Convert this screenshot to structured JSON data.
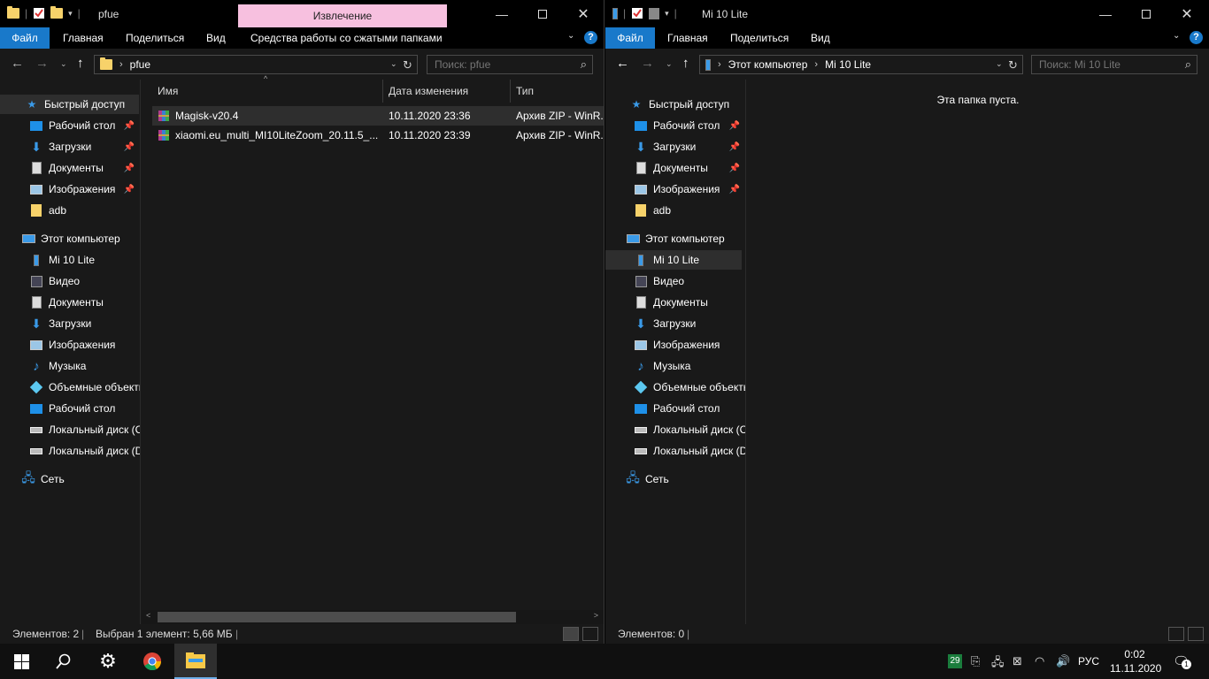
{
  "left_window": {
    "title": "pfue",
    "context_tab": "Извлечение",
    "ribbon_tabs": [
      "Файл",
      "Главная",
      "Поделиться",
      "Вид",
      "Средства работы со сжатыми папками"
    ],
    "address": {
      "crumbs": [
        "pfue"
      ]
    },
    "search_placeholder": "Поиск: pfue",
    "columns": [
      "Имя",
      "Дата изменения",
      "Тип"
    ],
    "files": [
      {
        "name": "Magisk-v20.4",
        "date": "10.11.2020 23:36",
        "type": "Архив ZIP - WinR..."
      },
      {
        "name": "xiaomi.eu_multi_MI10LiteZoom_20.11.5_...",
        "date": "10.11.2020 23:39",
        "type": "Архив ZIP - WinR..."
      }
    ],
    "status": {
      "count": "Элементов: 2",
      "selected": "Выбран 1 элемент: 5,66 МБ"
    }
  },
  "right_window": {
    "title": "Mi 10 Lite",
    "ribbon_tabs": [
      "Файл",
      "Главная",
      "Поделиться",
      "Вид"
    ],
    "address": {
      "crumbs": [
        "Этот компьютер",
        "Mi 10 Lite"
      ]
    },
    "search_placeholder": "Поиск: Mi 10 Lite",
    "empty_message": "Эта папка пуста.",
    "status": {
      "count": "Элементов: 0"
    }
  },
  "nav": {
    "quick_access": "Быстрый доступ",
    "quick_items": [
      "Рабочий стол",
      "Загрузки",
      "Документы",
      "Изображения",
      "adb"
    ],
    "this_pc": "Этот компьютер",
    "pc_items": [
      "Mi 10 Lite",
      "Видео",
      "Документы",
      "Загрузки",
      "Изображения",
      "Музыка",
      "Объемные объекты",
      "Рабочий стол",
      "Локальный диск (C:)",
      "Локальный диск (D:)"
    ],
    "network": "Сеть"
  },
  "taskbar": {
    "badge": "29",
    "language": "РУС",
    "time": "0:02",
    "date": "11.11.2020",
    "notifications": "1"
  }
}
